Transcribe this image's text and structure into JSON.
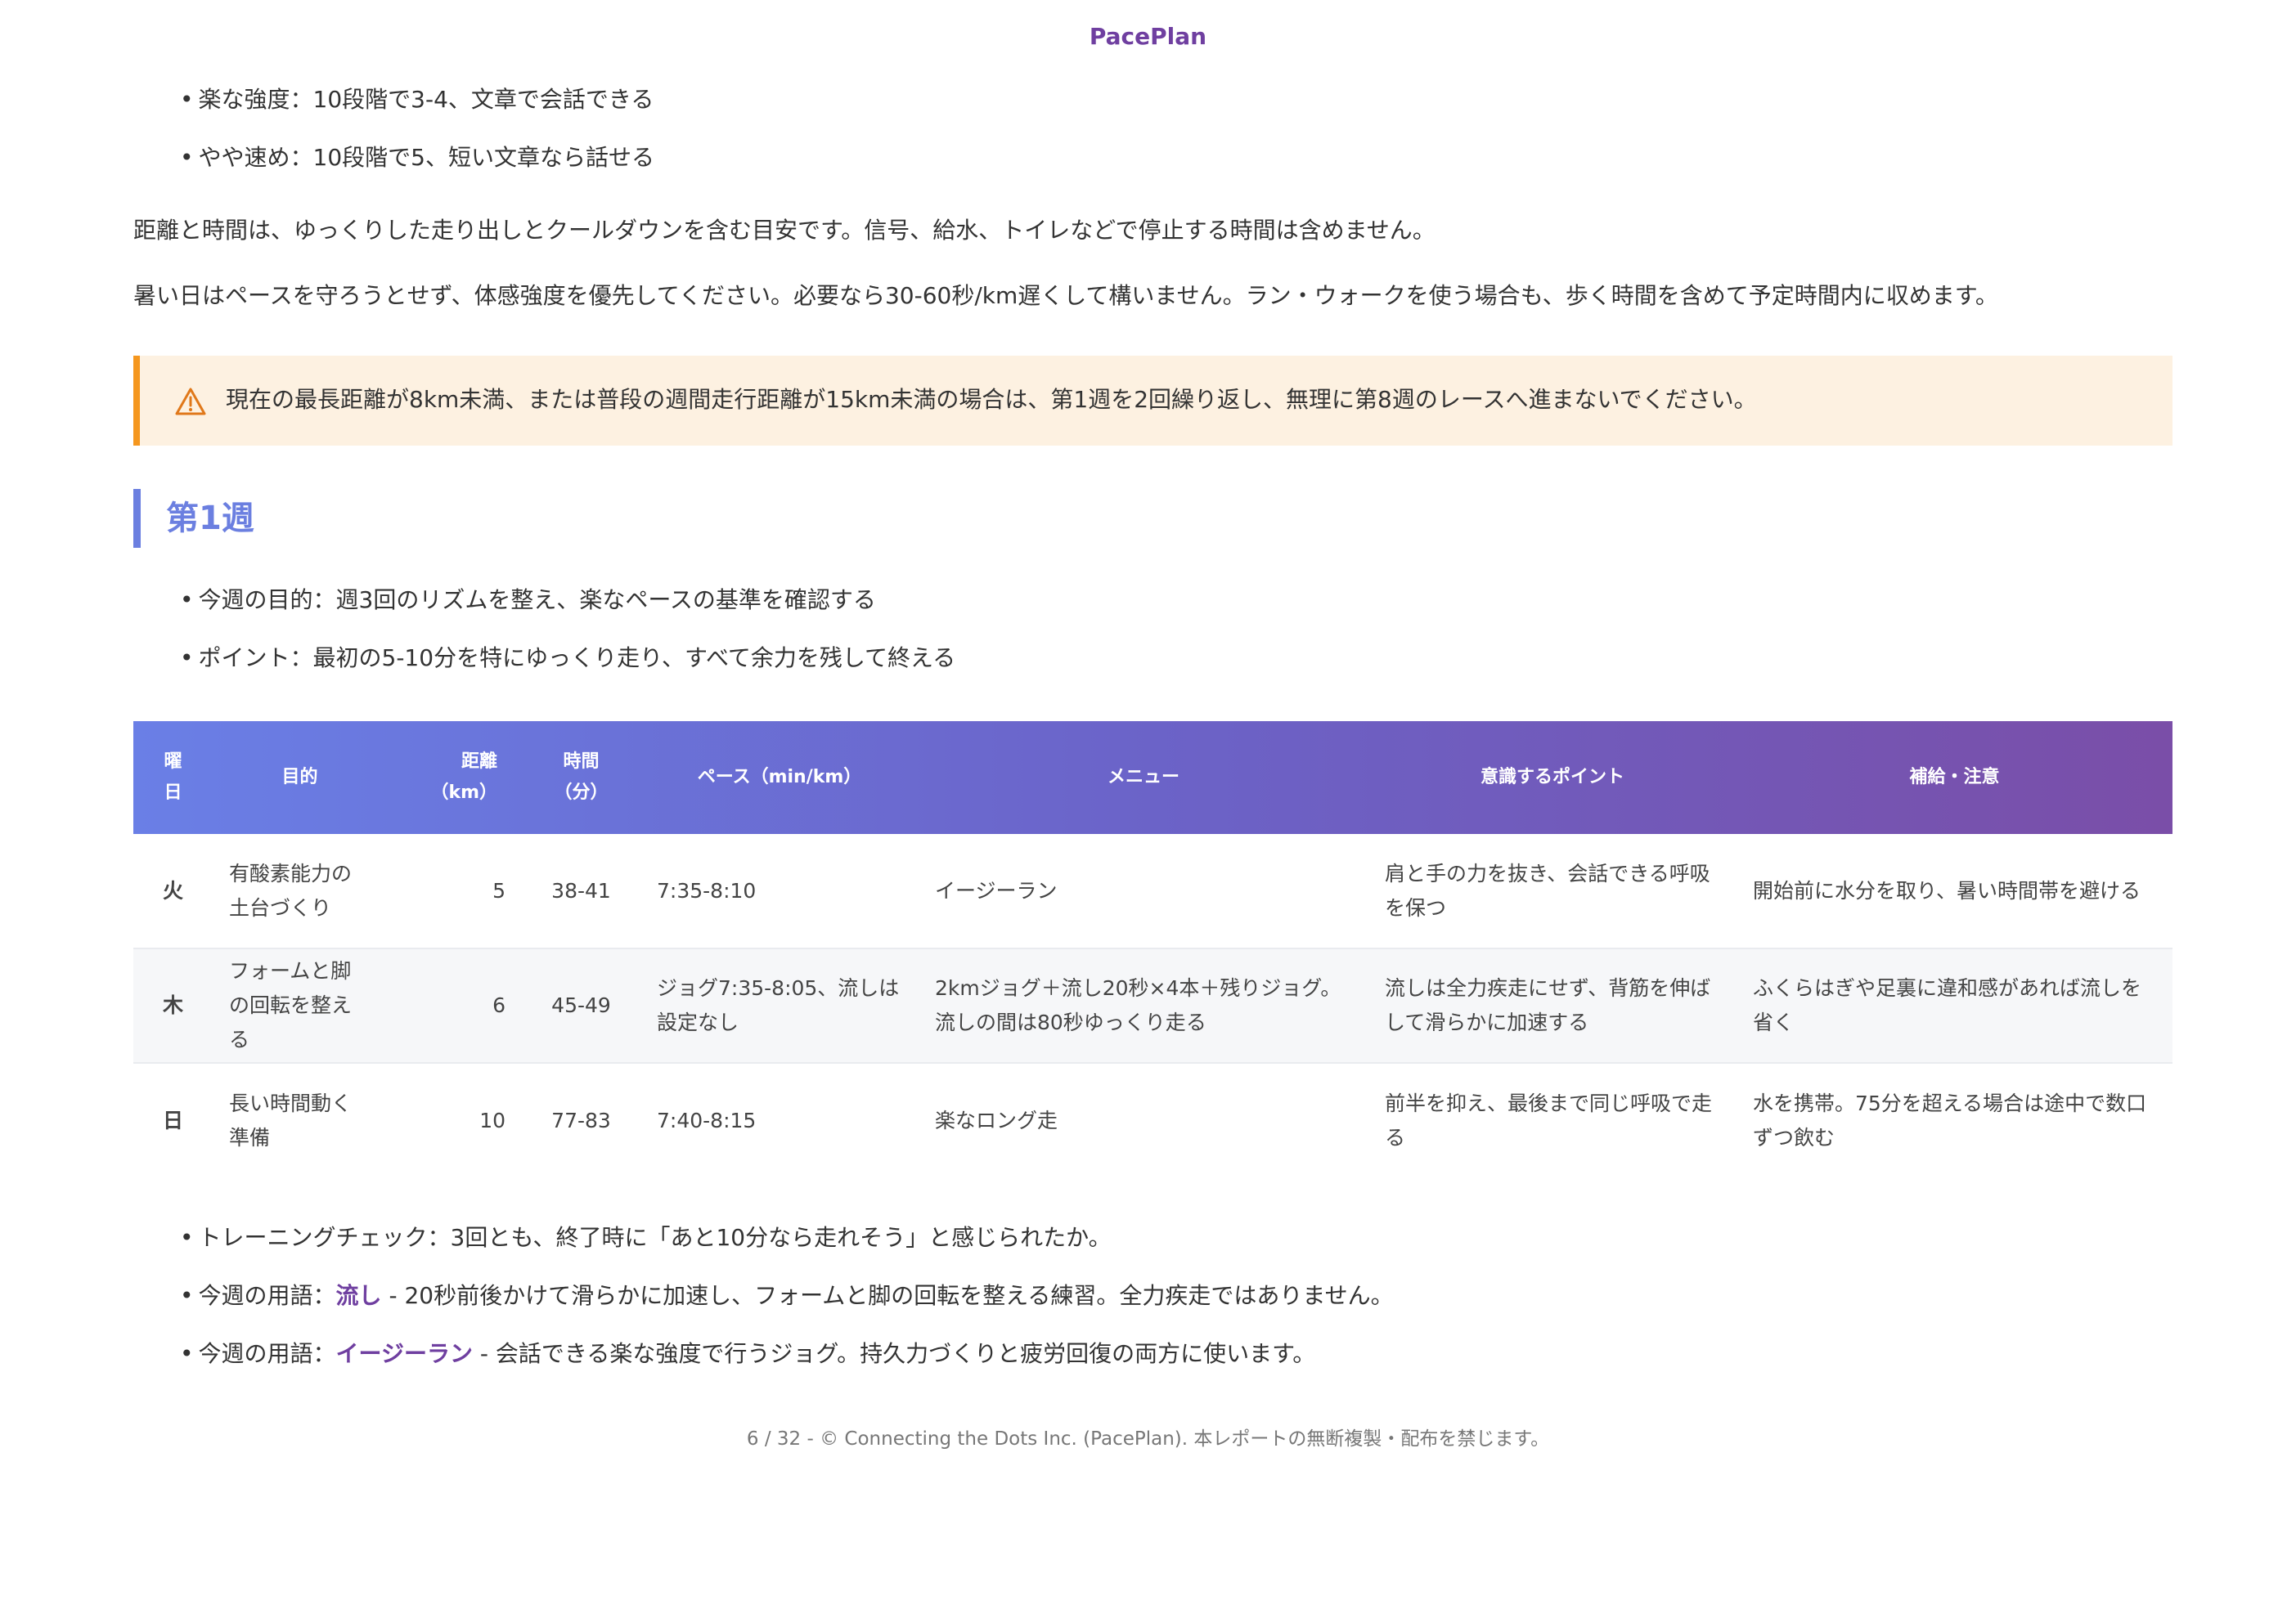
{
  "header": {
    "brand": "PacePlan"
  },
  "intensity": [
    "楽な強度：10段階で3-4、文章で会話できる",
    "やや速め：10段階で5、短い文章なら話せる"
  ],
  "notes": [
    "距離と時間は、ゆっくりした走り出しとクールダウンを含む目安です。信号、給水、トイレなどで停止する時間は含めません。",
    "暑い日はペースを守ろうとせず、体感強度を優先してください。必要なら30-60秒/km遅くして構いません。ラン・ウォークを使う場合も、歩く時間を含めて予定時間内に収めます。"
  ],
  "warning": {
    "icon": "warning-triangle-icon",
    "text": "現在の最長距離が8km未満、または普段の週間走行距離が15km未満の場合は、第1週を2回繰り返し、無理に第8週のレースへ進まないでください。",
    "color": "#f5971f"
  },
  "week": {
    "title": "第1週",
    "goals": [
      "今週の目的：週3回のリズムを整え、楽なペースの基準を確認する",
      "ポイント：最初の5-10分を特にゆっくり走り、すべて余力を残して終える"
    ]
  },
  "table": {
    "headers": {
      "day_1": "曜",
      "day_2": "日",
      "purpose": "目的",
      "distance_1": "距離",
      "distance_2": "（km）",
      "time_1": "時間",
      "time_2": "（分）",
      "pace": "ペース（min/km）",
      "menu": "メニュー",
      "focus": "意識するポイント",
      "care": "補給・注意"
    },
    "rows": [
      {
        "day": "火",
        "purpose": "有酸素能力の土台づくり",
        "distance": "5",
        "time": "38-41",
        "pace": "7:35-8:10",
        "menu": "イージーラン",
        "focus": "肩と手の力を抜き、会話できる呼吸を保つ",
        "care": "開始前に水分を取り、暑い時間帯を避ける"
      },
      {
        "day": "木",
        "purpose": "フォームと脚の回転を整える",
        "distance": "6",
        "time": "45-49",
        "pace": "ジョグ7:35-8:05、流しは設定なし",
        "menu": "2kmジョグ＋流し20秒×4本＋残りジョグ。流しの間は80秒ゆっくり走る",
        "focus": "流しは全力疾走にせず、背筋を伸ばして滑らかに加速する",
        "care": "ふくらはぎや足裏に違和感があれば流しを省く"
      },
      {
        "day": "日",
        "purpose": "長い時間動く準備",
        "distance": "10",
        "time": "77-83",
        "pace": "7:40-8:15",
        "menu": "楽なロング走",
        "focus": "前半を抑え、最後まで同じ呼吸で走る",
        "care": "水を携帯。75分を超える場合は途中で数口ずつ飲む"
      }
    ]
  },
  "after": {
    "check": "トレーニングチェック：3回とも、終了時に「あと10分なら走れそう」と感じられたか。",
    "term1_prefix": "今週の用語：",
    "term1_word": "流し",
    "term1_desc": " - 20秒前後かけて滑らかに加速し、フォームと脚の回転を整える練習。全力疾走ではありません。",
    "term2_prefix": "今週の用語：",
    "term2_word": "イージーラン",
    "term2_desc": " - 会話できる楽な強度で行うジョグ。持久力づくりと疲労回復の両方に使います。"
  },
  "footer": {
    "text": "6 / 32 - © Connecting the Dots Inc. (PacePlan). 本レポートの無断複製・配布を禁じます。"
  }
}
